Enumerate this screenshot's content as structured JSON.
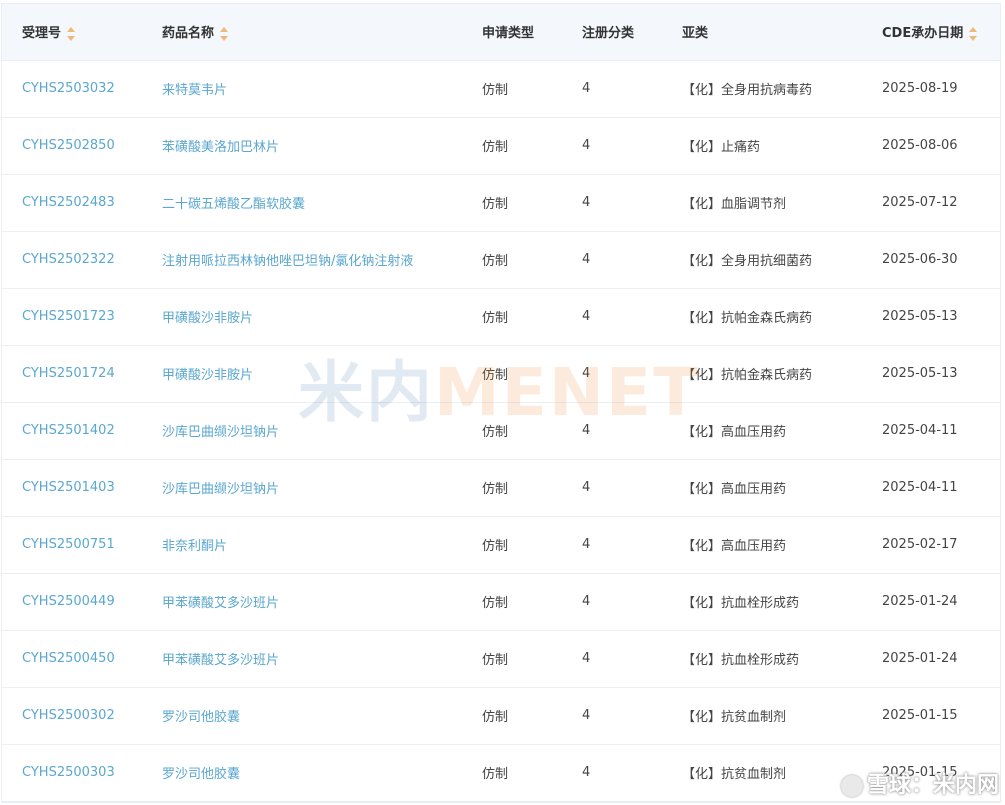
{
  "columns": [
    {
      "label": "受理号",
      "sortable": true
    },
    {
      "label": "药品名称",
      "sortable": true
    },
    {
      "label": "申请类型",
      "sortable": false
    },
    {
      "label": "注册分类",
      "sortable": false
    },
    {
      "label": "亚类",
      "sortable": false
    },
    {
      "label": "CDE承办日期",
      "sortable": true
    }
  ],
  "rows": [
    {
      "id": "CYHS2503032",
      "name": "来特莫韦片",
      "type": "仿制",
      "category": "4",
      "subclass": "【化】全身用抗病毒药",
      "date": "2025-08-19"
    },
    {
      "id": "CYHS2502850",
      "name": "苯磺酸美洛加巴林片",
      "type": "仿制",
      "category": "4",
      "subclass": "【化】止痛药",
      "date": "2025-08-06"
    },
    {
      "id": "CYHS2502483",
      "name": "二十碳五烯酸乙酯软胶囊",
      "type": "仿制",
      "category": "4",
      "subclass": "【化】血脂调节剂",
      "date": "2025-07-12"
    },
    {
      "id": "CYHS2502322",
      "name": "注射用哌拉西林钠他唑巴坦钠/氯化钠注射液",
      "type": "仿制",
      "category": "4",
      "subclass": "【化】全身用抗细菌药",
      "date": "2025-06-30"
    },
    {
      "id": "CYHS2501723",
      "name": "甲磺酸沙非胺片",
      "type": "仿制",
      "category": "4",
      "subclass": "【化】抗帕金森氏病药",
      "date": "2025-05-13"
    },
    {
      "id": "CYHS2501724",
      "name": "甲磺酸沙非胺片",
      "type": "仿制",
      "category": "4",
      "subclass": "【化】抗帕金森氏病药",
      "date": "2025-05-13"
    },
    {
      "id": "CYHS2501402",
      "name": "沙库巴曲缬沙坦钠片",
      "type": "仿制",
      "category": "4",
      "subclass": "【化】高血压用药",
      "date": "2025-04-11"
    },
    {
      "id": "CYHS2501403",
      "name": "沙库巴曲缬沙坦钠片",
      "type": "仿制",
      "category": "4",
      "subclass": "【化】高血压用药",
      "date": "2025-04-11"
    },
    {
      "id": "CYHS2500751",
      "name": "非奈利酮片",
      "type": "仿制",
      "category": "4",
      "subclass": "【化】高血压用药",
      "date": "2025-02-17"
    },
    {
      "id": "CYHS2500449",
      "name": "甲苯磺酸艾多沙班片",
      "type": "仿制",
      "category": "4",
      "subclass": "【化】抗血栓形成药",
      "date": "2025-01-24"
    },
    {
      "id": "CYHS2500450",
      "name": "甲苯磺酸艾多沙班片",
      "type": "仿制",
      "category": "4",
      "subclass": "【化】抗血栓形成药",
      "date": "2025-01-24"
    },
    {
      "id": "CYHS2500302",
      "name": "罗沙司他胶囊",
      "type": "仿制",
      "category": "4",
      "subclass": "【化】抗贫血制剂",
      "date": "2025-01-15"
    },
    {
      "id": "CYHS2500303",
      "name": "罗沙司他胶囊",
      "type": "仿制",
      "category": "4",
      "subclass": "【化】抗贫血制剂",
      "date": "2025-01-15"
    }
  ],
  "watermark": {
    "logo_cn": "米内",
    "logo_en": "MENET"
  },
  "corner_watermark": "雪球：米内网",
  "colors": {
    "link": "#5aa7cf",
    "header_bg": "#f4f8fc",
    "sort_arrow": "#f0b97a"
  }
}
